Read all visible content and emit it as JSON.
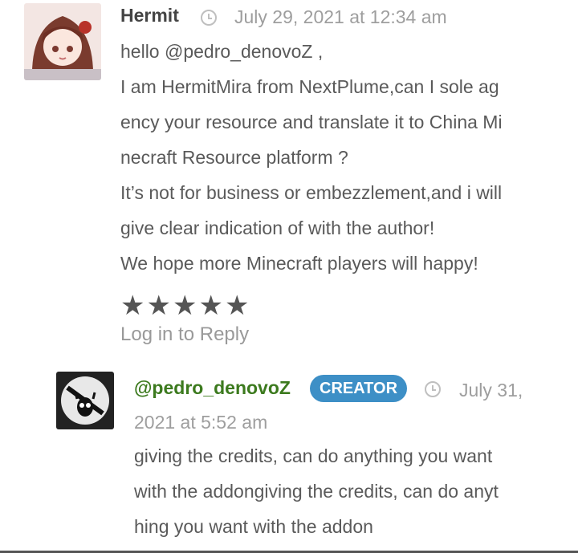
{
  "comment": {
    "author": "Hermit",
    "date": "July 29, 2021 at 12:34 am",
    "lines": [
      "hello @pedro_denovoZ ,",
      "I am HermitMira from NextPlume,can I sole ag",
      "ency your resource and translate it to China Mi",
      "necraft Resource platform ?",
      "It’s not for business or embezzlement,and i will",
      "give clear indication of with the author!",
      "We hope more Minecraft players will happy!"
    ],
    "rating": 5,
    "rating_max": 5,
    "reply_label": "Log in to Reply"
  },
  "reply": {
    "author": "@pedro_denovoZ",
    "badge": "CREATOR",
    "date_part1": "July 31,",
    "date_part2": "2021 at 5:52 am",
    "lines": [
      "giving the credits, can do anything you want",
      "with the addongiving the credits, can do anyt",
      "hing you want with the addon"
    ]
  },
  "colors": {
    "author_reply": "#3c7a1e",
    "badge_bg": "#3d8fc6",
    "meta": "#9e9e9e"
  },
  "icons": [
    "clock-icon",
    "star-icon"
  ]
}
